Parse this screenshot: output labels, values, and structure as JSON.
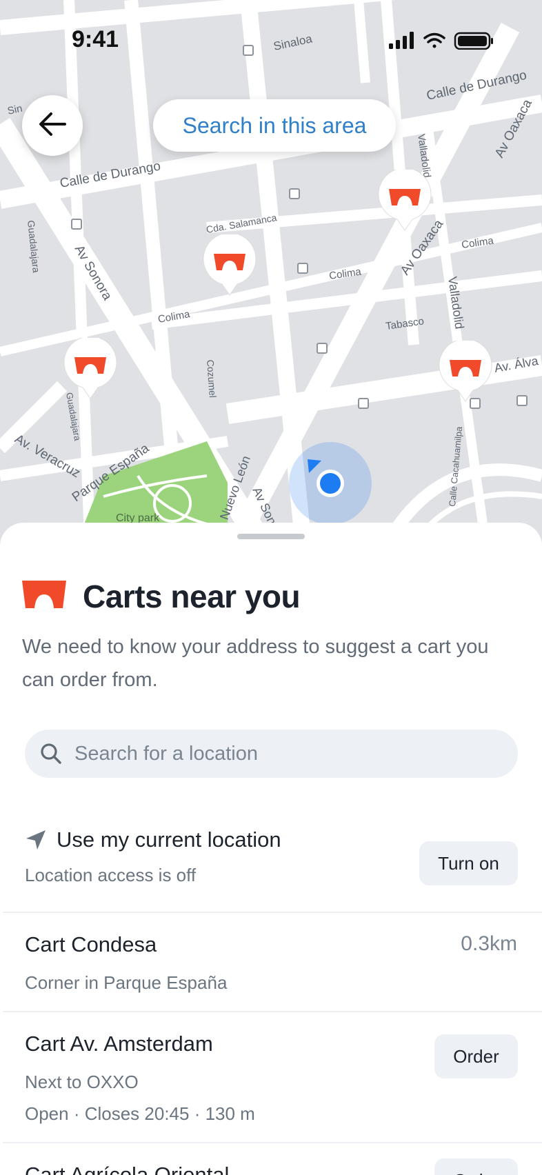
{
  "status_bar": {
    "time": "9:41"
  },
  "map": {
    "search_area_label": "Search in this area",
    "streets": [
      "Sinaloa",
      "Calle de Durango",
      "Calle de Durango",
      "Av Oaxaca",
      "Valladolid",
      "Cda. Salamanca",
      "Guadalajara",
      "Av Sonora",
      "Colima",
      "Colima",
      "Colima",
      "Av Oaxaca",
      "Valladolid",
      "Tabasco",
      "Cozumel",
      "Guadalajara",
      "Av. Álva",
      "Av. Veracruz",
      "Parque España",
      "City park",
      "Nuevo León",
      "Av Son",
      "Calle Cacahuamilpa",
      "Sin"
    ]
  },
  "sheet": {
    "title": "Carts near you",
    "description": "We need to know your address to suggest a cart you can order from.",
    "search_placeholder": "Search for a location",
    "current_location": {
      "title": "Use my current location",
      "subtitle": "Location access is off",
      "button": "Turn on"
    },
    "carts": [
      {
        "name": "Cart Condesa",
        "detail": "Corner in Parque España",
        "distance": "0.3km"
      },
      {
        "name": "Cart Av. Amsterdam",
        "detail": "Next to OXXO",
        "status": "Open · Closes 20:45 · 130 m",
        "button": "Order"
      },
      {
        "name": "Cart Agrícola Oriental",
        "button": "Order"
      }
    ]
  },
  "colors": {
    "brand": "#f04a2a",
    "accent_blue": "#2f80c8",
    "location_dot": "#1e7cf2"
  },
  "icons": [
    "back-arrow-icon",
    "cart-pin-icon",
    "search-icon",
    "navigation-arrow-icon",
    "cart-logo-icon",
    "signal-icon",
    "wifi-icon",
    "battery-icon"
  ]
}
